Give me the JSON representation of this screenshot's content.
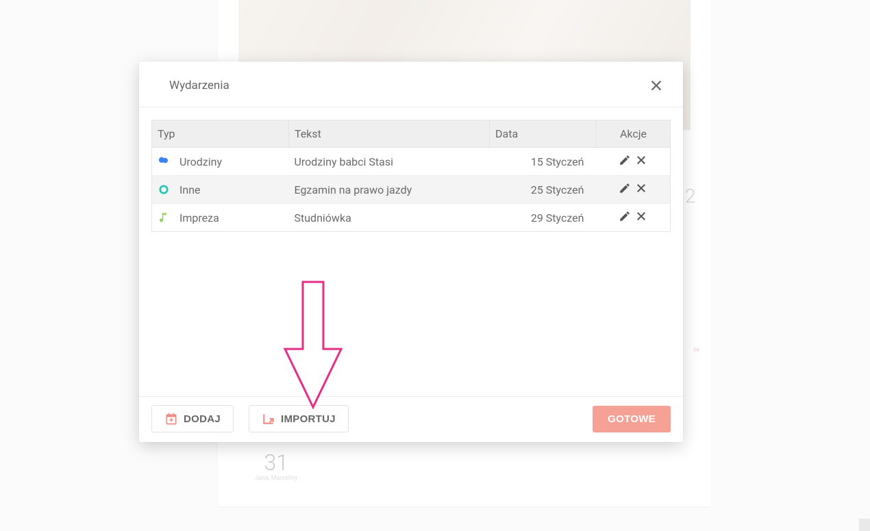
{
  "modal": {
    "title": "Wydarzenia",
    "columns": {
      "type": "Typ",
      "text": "Tekst",
      "date": "Data",
      "actions": "Akcje"
    },
    "rows": [
      {
        "icon": "balloons",
        "icon_color": "#3b82f6",
        "type_label": "Urodziny",
        "text": "Urodziny babci Stasi",
        "date": "15 Styczeń"
      },
      {
        "icon": "ring",
        "icon_color": "#1fc7b6",
        "type_label": "Inne",
        "text": "Egzamin na prawo jazdy",
        "date": "25 Styczeń"
      },
      {
        "icon": "music",
        "icon_color": "#97d65c",
        "type_label": "Impreza",
        "text": "Studniówka",
        "date": "29 Styczeń"
      }
    ],
    "buttons": {
      "add": "DODAJ",
      "import": "IMPORTUJ",
      "done": "GOTOWE"
    }
  },
  "background": {
    "year_fragment": "2",
    "day_number": "31",
    "day_names": "Jana, Marceliny",
    "tiny_label": "za"
  },
  "annotation": {
    "arrow_color": "#e62e86"
  }
}
